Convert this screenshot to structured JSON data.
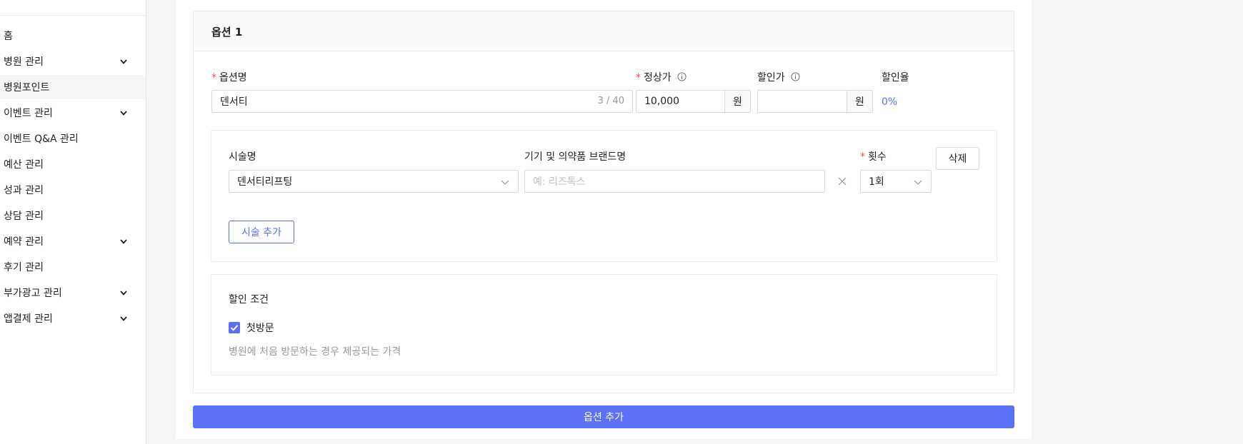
{
  "sidebar": {
    "items": [
      {
        "label": "홈",
        "has_children": false
      },
      {
        "label": "병원 관리",
        "has_children": true
      },
      {
        "label": "병원포인트",
        "has_children": false,
        "active": true
      },
      {
        "label": "이벤트 관리",
        "has_children": true
      },
      {
        "label": "이벤트 Q&A 관리",
        "has_children": false
      },
      {
        "label": "예산 관리",
        "has_children": false
      },
      {
        "label": "성과 관리",
        "has_children": false
      },
      {
        "label": "상담 관리",
        "has_children": false
      },
      {
        "label": "예약 관리",
        "has_children": true
      },
      {
        "label": "후기 관리",
        "has_children": false
      },
      {
        "label": "부가광고 관리",
        "has_children": true
      },
      {
        "label": "앱결제 관리",
        "has_children": true
      }
    ]
  },
  "option": {
    "title": "옵션 1",
    "name_label": "옵션명",
    "name_value": "덴서티",
    "name_counter": "3 / 40",
    "price_label": "정상가",
    "price_value": "10,000",
    "price_unit": "원",
    "discount_label": "할인가",
    "discount_value": "",
    "discount_unit": "원",
    "rate_label": "할인율",
    "rate_value": "0%",
    "procedure": {
      "name_label": "시술명",
      "name_value": "덴서티리프팅",
      "brand_label": "기기 및 의약품 브랜드명",
      "brand_placeholder": "예: 리즈톡스",
      "count_label": "횟수",
      "count_value": "1회",
      "delete_label": "삭제",
      "add_label": "시술 추가"
    },
    "condition": {
      "title": "할인 조건",
      "checkbox_label": "첫방문",
      "checkbox_checked": true,
      "hint": "병원에 처음 방문하는 경우 제공되는 가격"
    }
  },
  "add_option_label": "옵션 추가",
  "colors": {
    "accent": "#5b71f7",
    "required": "#ff4d4f"
  }
}
